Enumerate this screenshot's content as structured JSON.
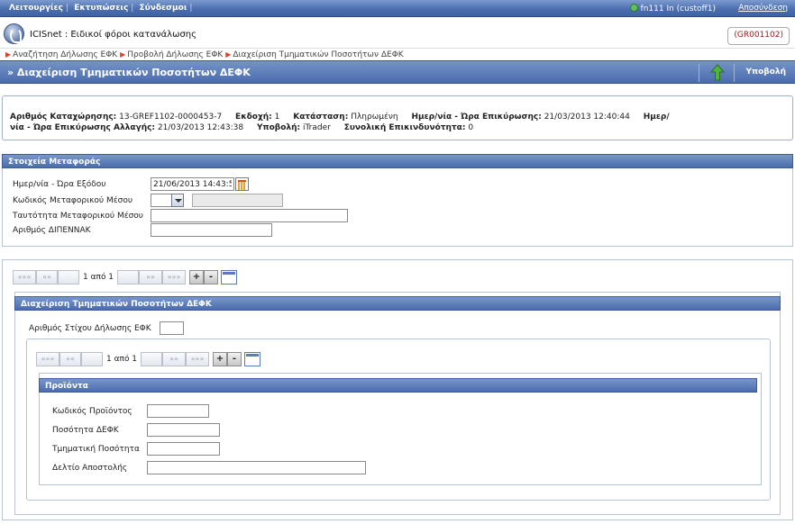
{
  "topbar": {
    "menu": [
      "Λειτουργίες",
      "Εκτυπώσεις",
      "Σύνδεσμοι"
    ],
    "user": "fn111 In (custoff1)",
    "logout": "Αποσύνδεση"
  },
  "app": {
    "title": "ICISnet : Ειδικοί φόροι κατανάλωσης",
    "code": "(GR001102)"
  },
  "breadcrumbs": [
    "Αναζήτηση Δήλωσης ΕΦΚ",
    "Προβολή Δήλωσης ΕΦΚ",
    "Διαχείριση Τμηματικών Ποσοτήτων ΔΕΦΚ"
  ],
  "page": {
    "title": "» Διαχείριση Τμηματικών Ποσοτήτων ΔΕΦΚ",
    "submit_label": "Υποβολή"
  },
  "info": {
    "reg_no_label": "Αριθμός Καταχώρησης:",
    "reg_no": "13-GREF1102-0000453-7",
    "version_label": "Εκδοχή:",
    "version": "1",
    "status_label": "Κατάσταση:",
    "status": "Πληρωμένη",
    "confirm_label": "Ημερ/νία - Ώρα Επικύρωσης:",
    "confirm": "21/03/2013 12:40:44",
    "change_label_a": "Ημερ/",
    "change_label_b": "νία - Ώρα Επικύρωσης Αλλαγής:",
    "change": "21/03/2013 12:43:38",
    "submitter_label": "Υποβολή:",
    "submitter": "iTrader",
    "risk_label": "Συνολική Επικινδυνότητα:",
    "risk": "0"
  },
  "transport": {
    "header": "Στοιχεία Μεταφοράς",
    "exit_label": "Ημερ/νία - Ώρα Εξόδου",
    "exit_value": "21/06/2013 14:43:5",
    "means_code_label": "Κωδικός Μεταφορικού Μέσου",
    "means_id_label": "Ταυτότητα Μεταφορικού Μέσου",
    "dipennak_label": "Αριθμός ΔΙΠΕΝΝΑΚ"
  },
  "pager_outer": {
    "first": "«««",
    "prev": "««",
    "text": "1 από 1",
    "next": "»»",
    "last": "»»»",
    "add": "+",
    "remove": "-"
  },
  "partials": {
    "header": "Διαχείριση Τμηματικών Ποσοτήτων ΔΕΦΚ",
    "line_no_label": "Αριθμός Στίχου Δήλωσης ΕΦΚ"
  },
  "pager_inner": {
    "first": "«««",
    "prev": "««",
    "text": "1 από 1",
    "next": "»»",
    "last": "»»»",
    "add": "+",
    "remove": "-"
  },
  "products": {
    "header": "Προϊόντα",
    "code_label": "Κωδικός Προϊόντος",
    "qty_label": "Ποσότητα ΔΕΦΚ",
    "partial_label": "Τμηματική Ποσότητα",
    "delivery_label": "Δελτίο Αποστολής"
  }
}
